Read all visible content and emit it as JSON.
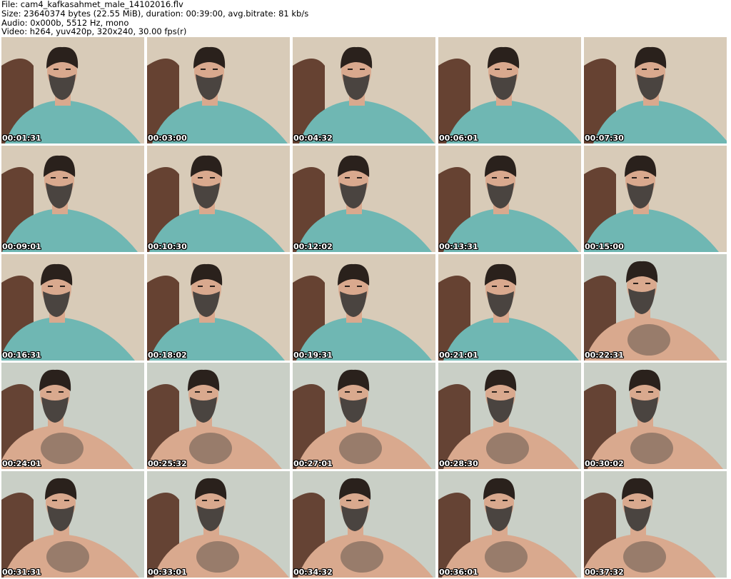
{
  "header": {
    "file": "File: cam4_kafkasahmet_male_14102016.flv",
    "size": "Size: 23640374 bytes (22.55 MiB), duration: 00:39:00, avg.bitrate: 81 kb/s",
    "audio": "Audio: 0x000b, 5512 Hz, mono",
    "video": "Video: h264, yuv420p, 320x240, 30.00 fps(r)"
  },
  "thumbnails": [
    {
      "timestamp": "00:01:31",
      "shirt": true
    },
    {
      "timestamp": "00:03:00",
      "shirt": true
    },
    {
      "timestamp": "00:04:32",
      "shirt": true
    },
    {
      "timestamp": "00:06:01",
      "shirt": true
    },
    {
      "timestamp": "00:07:30",
      "shirt": true
    },
    {
      "timestamp": "00:09:01",
      "shirt": true
    },
    {
      "timestamp": "00:10:30",
      "shirt": true
    },
    {
      "timestamp": "00:12:02",
      "shirt": true
    },
    {
      "timestamp": "00:13:31",
      "shirt": true
    },
    {
      "timestamp": "00:15:00",
      "shirt": true
    },
    {
      "timestamp": "00:16:31",
      "shirt": true
    },
    {
      "timestamp": "00:18:02",
      "shirt": true
    },
    {
      "timestamp": "00:19:31",
      "shirt": true
    },
    {
      "timestamp": "00:21:01",
      "shirt": true
    },
    {
      "timestamp": "00:22:31",
      "shirt": false
    },
    {
      "timestamp": "00:24:01",
      "shirt": false
    },
    {
      "timestamp": "00:25:32",
      "shirt": false
    },
    {
      "timestamp": "00:27:01",
      "shirt": false
    },
    {
      "timestamp": "00:28:30",
      "shirt": false
    },
    {
      "timestamp": "00:30:02",
      "shirt": false
    },
    {
      "timestamp": "00:31:31",
      "shirt": false
    },
    {
      "timestamp": "00:33:01",
      "shirt": false
    },
    {
      "timestamp": "00:34:32",
      "shirt": false
    },
    {
      "timestamp": "00:36:01",
      "shirt": false
    },
    {
      "timestamp": "00:37:32",
      "shirt": false
    }
  ],
  "colors": {
    "background": "#ffffff",
    "wall_warm": "#d8cbb8",
    "wall_cool": "#c9cfc6",
    "chair": "#5a3324",
    "shirt": "#6fb7b3",
    "skin": "#d9a98e",
    "hair": "#2a211c",
    "beard": "#4a4440",
    "timestamp_text": "#ffffff"
  }
}
